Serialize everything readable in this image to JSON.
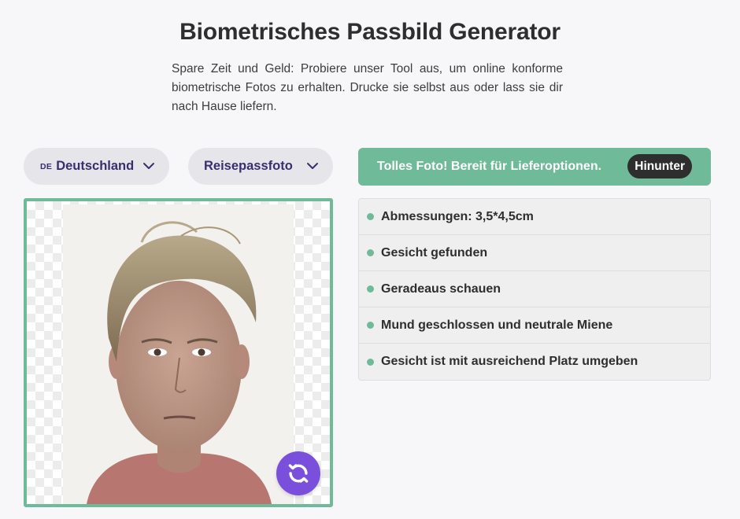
{
  "page": {
    "title": "Biometrisches Passbild Generator",
    "intro": "Spare Zeit und Geld: Probiere unser Tool aus, um online konforme biometrische Fotos zu erhalten. Drucke sie selbst aus oder lass sie dir nach Hause liefern."
  },
  "selectors": {
    "country": {
      "code": "DE",
      "label": "Deutschland",
      "icon": "chevron-down-icon"
    },
    "doc_type": {
      "label": "Reisepassfoto",
      "icon": "chevron-down-icon"
    }
  },
  "photo": {
    "background": "transparent-checkerboard",
    "refresh_icon": "refresh-icon"
  },
  "status": {
    "message": "Tolles Foto! Bereit für Lieferoptionen.",
    "button_label": "Hinunter"
  },
  "checks": [
    {
      "label": "Abmessungen: 3,5*4,5cm"
    },
    {
      "label": "Gesicht gefunden"
    },
    {
      "label": "Geradeaus schauen"
    },
    {
      "label": "Mund geschlossen und neutrale Miene"
    },
    {
      "label": "Gesicht ist mit ausreichend Platz umgeben"
    }
  ],
  "colors": {
    "accent_green": "#6fba98",
    "accent_purple": "#7a4fdc",
    "selector_text": "#3b2e6e",
    "dark_button": "#2e2e2e"
  }
}
